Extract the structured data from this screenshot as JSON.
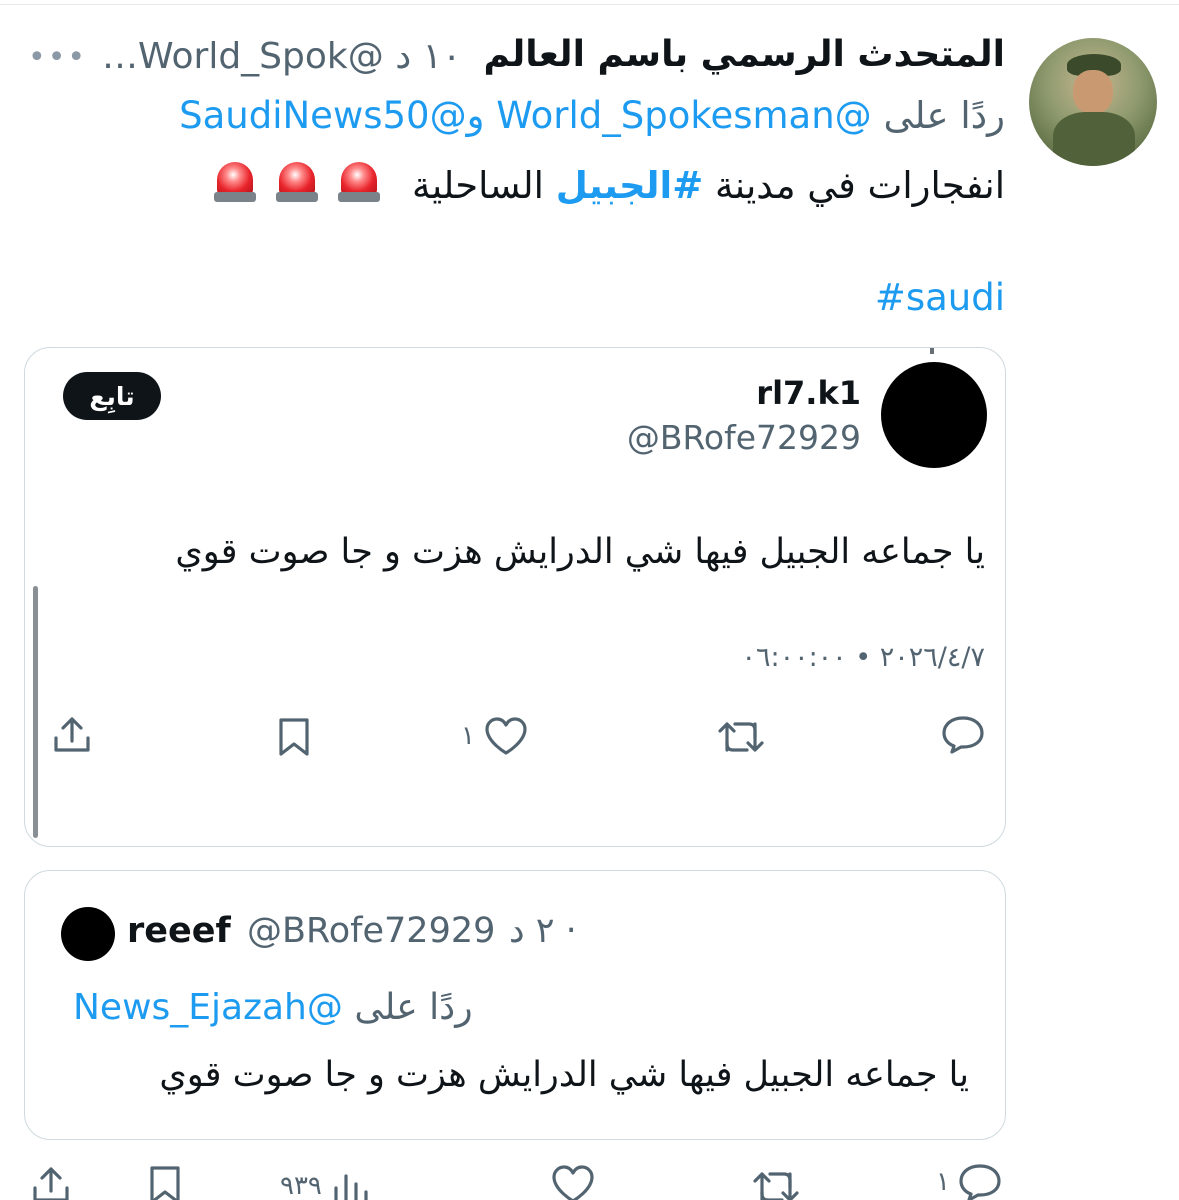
{
  "tweet": {
    "author_name": "المتحدث الرسمي باسم العالم",
    "handle_time": "…World_Spok@ ١٠ د",
    "more_icon": "more-icon",
    "reply_prefix": "ردًا على",
    "reply_to_1": "@World_Spokesman",
    "reply_joiner": "و",
    "reply_to_2": "@SaudiNews50",
    "text_part1": "انفجارات في مدينة",
    "hashtag_1": "#الجبيل",
    "text_part2": "الساحلية",
    "emoji": "siren-emoji",
    "hashtag_2": "#saudi"
  },
  "embedded_tweet": {
    "name": "rl7.k1",
    "handle": "@BRofe72929",
    "follow_label": "تابِع",
    "text": "يا جماعه الجبيل فيها شي الدرايش هزت و جا صوت قوي",
    "timestamp": "٢٠٢٦/٤/٧ • ٠٦:٠٠:٠٠",
    "like_count": "١",
    "actions": [
      "reply-icon",
      "retweet-icon",
      "like-icon",
      "bookmark-icon",
      "share-icon"
    ]
  },
  "quoted_tweet": {
    "name": "reeef",
    "handle": "@BRofe72929",
    "time": "· ٢ د",
    "reply_prefix": "ردًا على",
    "reply_to": "@News_Ejazah",
    "text": "يا جماعه الجبيل فيها شي الدرايش هزت و جا صوت قوي"
  },
  "bottom_actions": {
    "reply_count": "١",
    "views_count": "٩٣٩"
  }
}
